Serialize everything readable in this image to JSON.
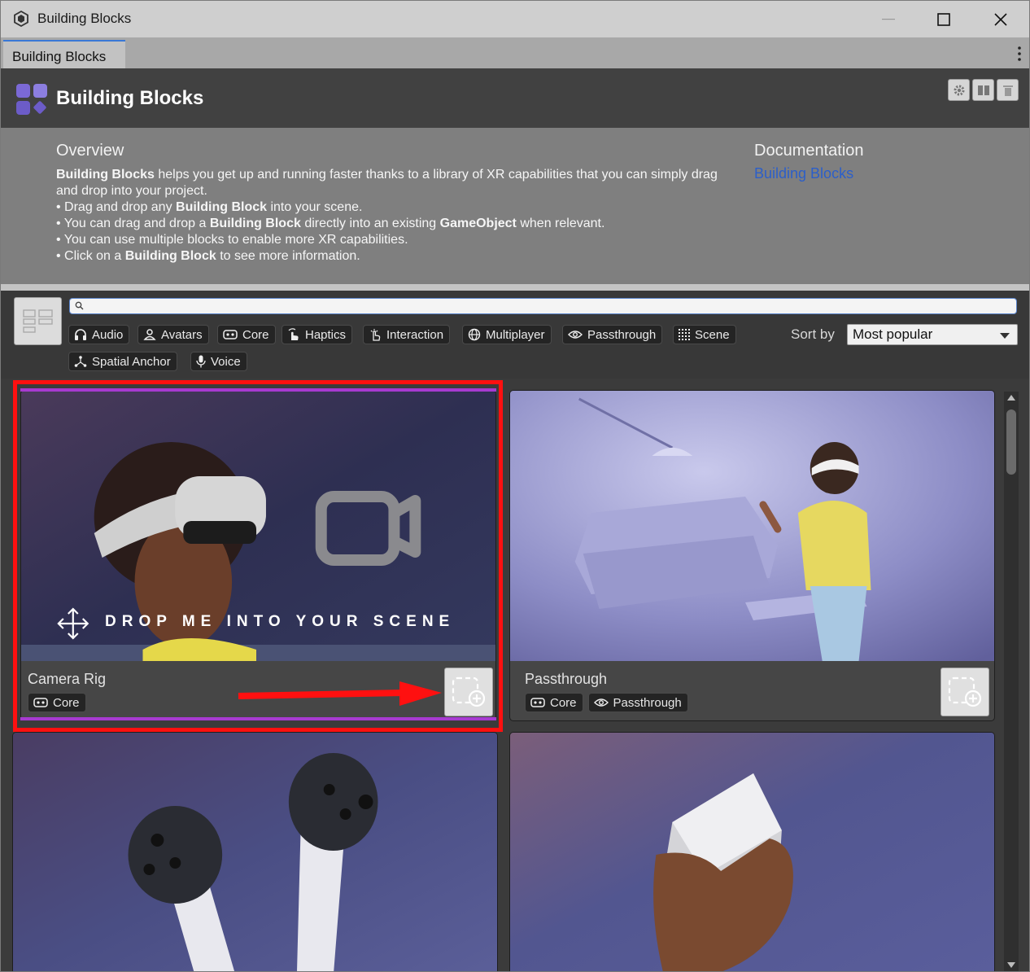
{
  "window": {
    "title": "Building Blocks",
    "tab_label": "Building Blocks"
  },
  "header": {
    "title": "Building Blocks",
    "icons": [
      "settings-icon",
      "columns-icon",
      "delete-icon"
    ]
  },
  "overview": {
    "title": "Overview",
    "intro_bold": "Building Blocks",
    "intro_rest": " helps you get up and running faster thanks to a library of XR capabilities that you can simply drag and drop into your project.",
    "bullet1_pre": "• Drag and drop any ",
    "bullet1_bold": "Building Block",
    "bullet1_post": " into your scene.",
    "bullet2_pre": "• You can drag and drop a ",
    "bullet2_bold": "Building Block",
    "bullet2_mid": " directly into an existing ",
    "bullet2_bold2": "GameObject",
    "bullet2_post": " when relevant.",
    "bullet3": "• You can use multiple blocks to enable more XR capabilities.",
    "bullet4_pre": "• Click on a ",
    "bullet4_bold": "Building Block",
    "bullet4_post": " to see more information."
  },
  "documentation": {
    "title": "Documentation",
    "link": "Building Blocks"
  },
  "filters": {
    "search_value": "",
    "chips": [
      {
        "label": "Audio",
        "icon": "headphones-icon"
      },
      {
        "label": "Avatars",
        "icon": "person-icon"
      },
      {
        "label": "Core",
        "icon": "headset-icon"
      },
      {
        "label": "Haptics",
        "icon": "haptics-hand-icon"
      },
      {
        "label": "Interaction",
        "icon": "pointer-hand-icon"
      },
      {
        "label": "Multiplayer",
        "icon": "globe-icon"
      },
      {
        "label": "Passthrough",
        "icon": "eye-icon"
      },
      {
        "label": "Scene",
        "icon": "grid-icon"
      },
      {
        "label": "Spatial Anchor",
        "icon": "anchor-nodes-icon"
      },
      {
        "label": "Voice",
        "icon": "microphone-icon"
      }
    ],
    "sort_label": "Sort by",
    "sort_value": "Most popular"
  },
  "cards": [
    {
      "name": "Camera Rig",
      "tags": [
        "Core"
      ],
      "overlay": "DROP ME INTO YOUR SCENE"
    },
    {
      "name": "Passthrough",
      "tags": [
        "Core",
        "Passthrough"
      ]
    },
    {
      "name": "",
      "tags": []
    },
    {
      "name": "",
      "tags": []
    }
  ],
  "colors": {
    "accent_red": "#ff1010",
    "accent_purple": "#a73ad1",
    "link_blue": "#2c5fc9"
  }
}
